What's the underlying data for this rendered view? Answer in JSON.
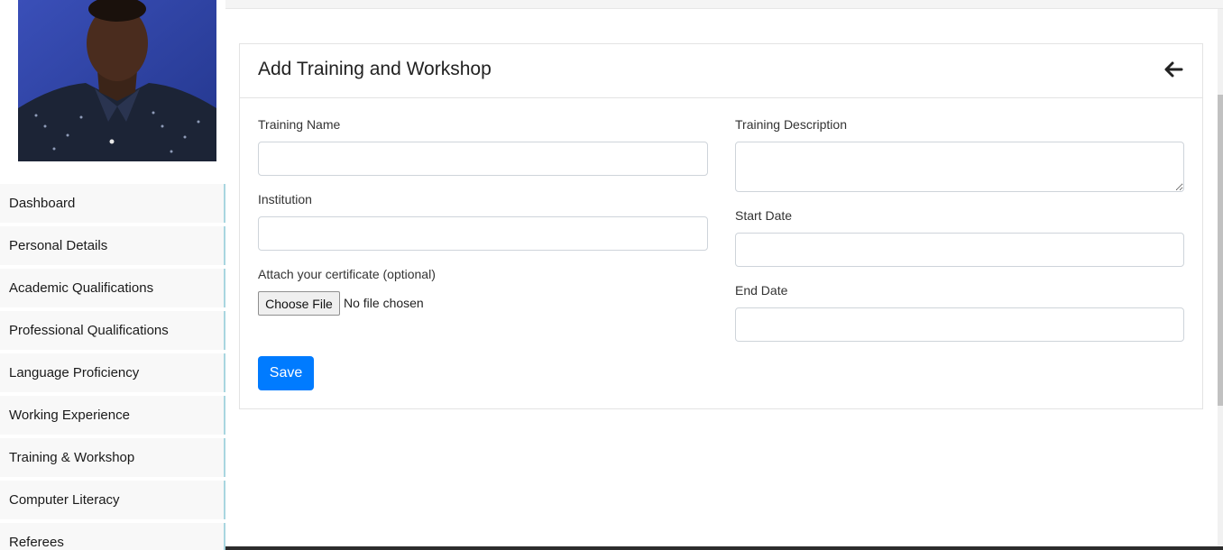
{
  "sidebar": {
    "items": [
      {
        "label": "Dashboard"
      },
      {
        "label": "Personal Details"
      },
      {
        "label": "Academic Qualifications"
      },
      {
        "label": "Professional Qualifications"
      },
      {
        "label": "Language Proficiency"
      },
      {
        "label": "Working Experience"
      },
      {
        "label": "Training & Workshop"
      },
      {
        "label": "Computer Literacy"
      },
      {
        "label": "Referees"
      }
    ]
  },
  "card": {
    "title": "Add Training and Workshop",
    "back_icon": "arrow-left-icon"
  },
  "form": {
    "training_name_label": "Training Name",
    "training_name_value": "",
    "institution_label": "Institution",
    "institution_value": "",
    "certificate_label": "Attach your certificate (optional)",
    "choose_file_label": "Choose File",
    "file_status": "No file chosen",
    "description_label": "Training Description",
    "description_value": "",
    "start_date_label": "Start Date",
    "start_date_value": "",
    "end_date_label": "End Date",
    "end_date_value": "",
    "save_label": "Save"
  },
  "colors": {
    "primary": "#007bff",
    "sidebar_accent": "#a9d6e0"
  }
}
